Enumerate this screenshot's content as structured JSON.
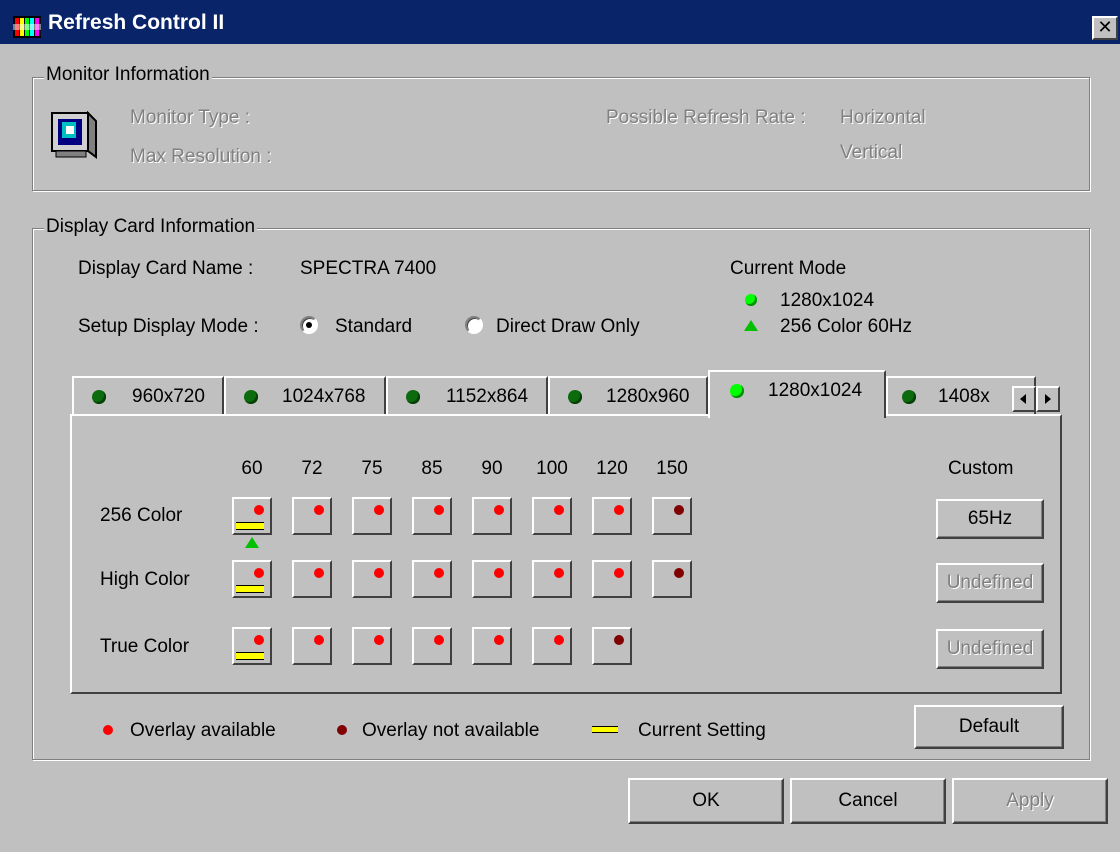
{
  "window": {
    "title": "Refresh Control II"
  },
  "monitor": {
    "group_label": "Monitor Information",
    "type_label": "Monitor Type :",
    "max_res_label": "Max Resolution :",
    "refresh_label": "Possible Refresh Rate :",
    "horizontal_label": "Horizontal",
    "vertical_label": "Vertical"
  },
  "display_card": {
    "group_label": "Display Card Information",
    "name_label": "Display Card Name :",
    "name_value": "SPECTRA 7400",
    "setup_label": "Setup Display Mode :",
    "mode_standard": "Standard",
    "mode_direct": "Direct Draw Only",
    "selected_mode": "Standard",
    "current_mode": {
      "label": "Current Mode",
      "resolution": "1280x1024",
      "color_rate": "256 Color 60Hz"
    }
  },
  "tabs": [
    {
      "label": "960x720",
      "active": false
    },
    {
      "label": "1024x768",
      "active": false
    },
    {
      "label": "1152x864",
      "active": false
    },
    {
      "label": "1280x960",
      "active": false
    },
    {
      "label": "1280x1024",
      "active": true
    },
    {
      "label": "1408x",
      "active": false
    }
  ],
  "grid": {
    "rates": [
      "60",
      "72",
      "75",
      "85",
      "90",
      "100",
      "120",
      "150"
    ],
    "custom_label": "Custom",
    "rows": [
      {
        "label": "256 Color",
        "cells": [
          "current",
          "avail",
          "avail",
          "avail",
          "avail",
          "avail",
          "avail",
          "na"
        ],
        "custom": "65Hz",
        "custom_enabled": true
      },
      {
        "label": "High Color",
        "cells": [
          "current",
          "avail",
          "avail",
          "avail",
          "avail",
          "avail",
          "avail",
          "na"
        ],
        "custom": "Undefined",
        "custom_enabled": false
      },
      {
        "label": "True Color",
        "cells": [
          "current",
          "avail",
          "avail",
          "avail",
          "avail",
          "avail",
          "na"
        ],
        "custom": "Undefined",
        "custom_enabled": false
      }
    ]
  },
  "legend": {
    "overlay_available": "Overlay available",
    "overlay_not_available": "Overlay not available",
    "current_setting": "Current Setting"
  },
  "buttons": {
    "default": "Default",
    "ok": "OK",
    "cancel": "Cancel",
    "apply": "Apply"
  },
  "colors": {
    "titlebar": "#0a246a",
    "face": "#c0c0c0",
    "overlay_available": "#ff0000",
    "overlay_not_available": "#800000",
    "current_setting": "#ffff00",
    "active_led": "#00ff00"
  }
}
